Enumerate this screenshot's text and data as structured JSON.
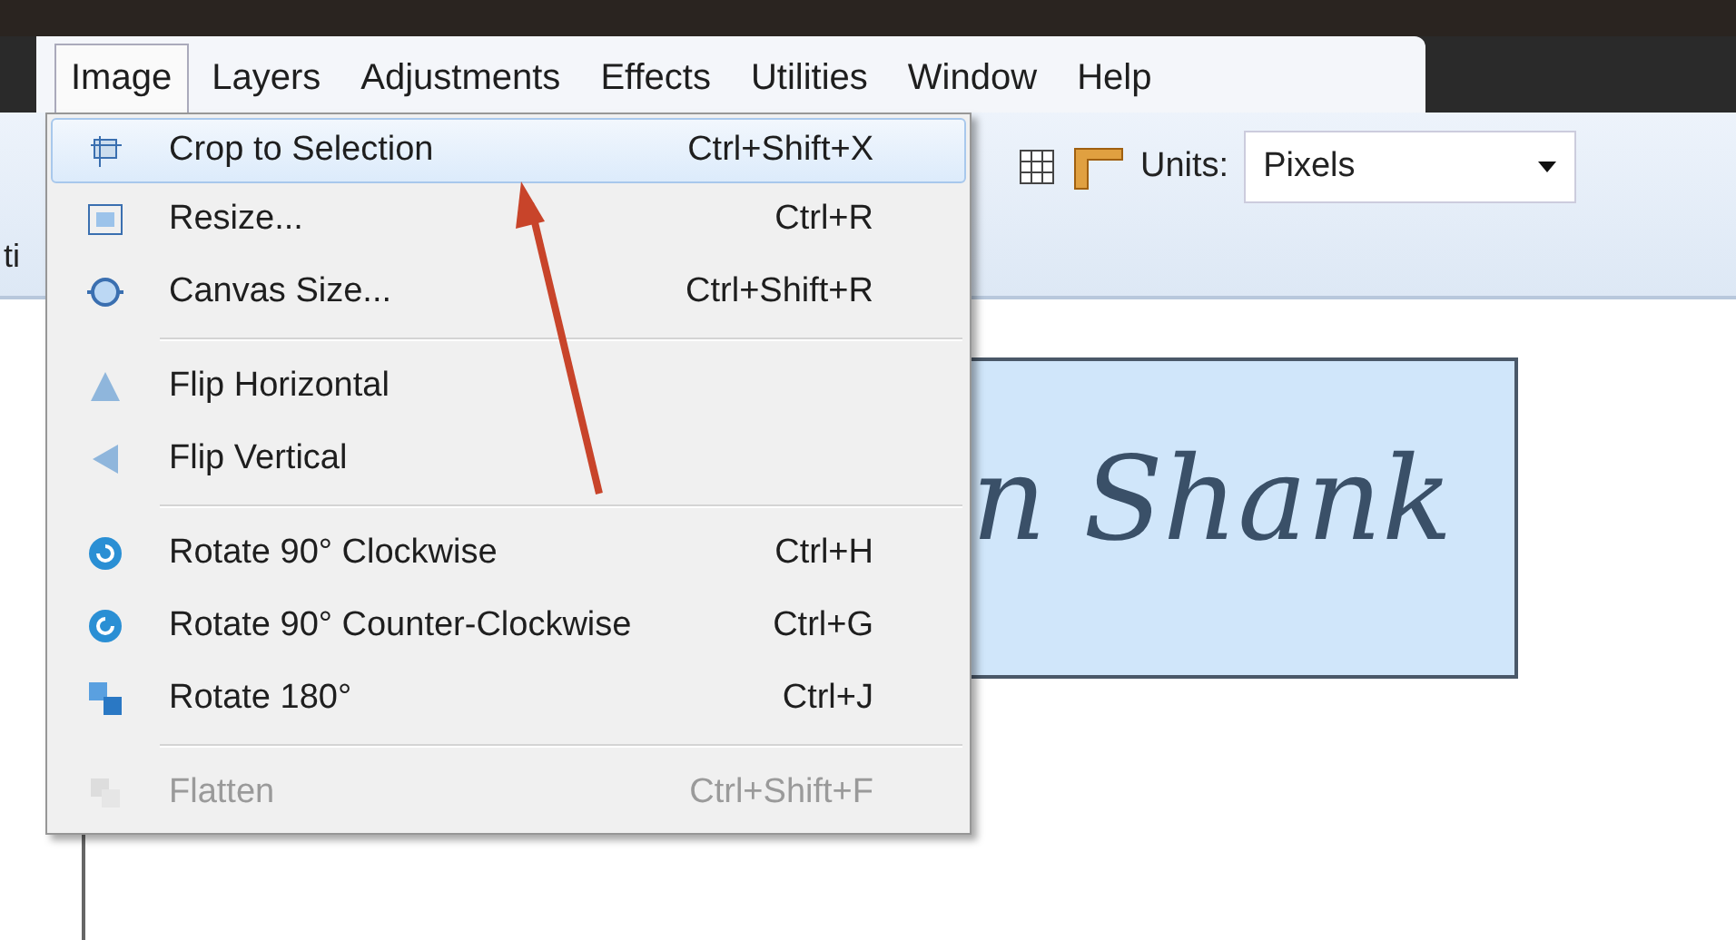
{
  "menu_bar": [
    {
      "label": "Image",
      "selected": true
    },
    {
      "label": "Layers",
      "selected": false
    },
    {
      "label": "Adjustments",
      "selected": false
    },
    {
      "label": "Effects",
      "selected": false
    },
    {
      "label": "Utilities",
      "selected": false
    },
    {
      "label": "Window",
      "selected": false
    },
    {
      "label": "Help",
      "selected": false
    }
  ],
  "toolbar": {
    "cut_label": "ti",
    "units_label": "Units:",
    "units_value": "Pixels"
  },
  "image_menu": [
    {
      "kind": "item",
      "label": "Crop to Selection",
      "shortcut": "Ctrl+Shift+X",
      "selected": true,
      "disabled": false
    },
    {
      "kind": "item",
      "label": "Resize...",
      "shortcut": "Ctrl+R",
      "selected": false,
      "disabled": false
    },
    {
      "kind": "item",
      "label": "Canvas Size...",
      "shortcut": "Ctrl+Shift+R",
      "selected": false,
      "disabled": false
    },
    {
      "kind": "separator"
    },
    {
      "kind": "item",
      "label": "Flip Horizontal",
      "selected": false,
      "disabled": false
    },
    {
      "kind": "item",
      "label": "Flip Vertical",
      "selected": false,
      "disabled": false
    },
    {
      "kind": "separator"
    },
    {
      "kind": "item",
      "label": "Rotate 90° Clockwise",
      "shortcut": "Ctrl+H",
      "selected": false,
      "disabled": false
    },
    {
      "kind": "item",
      "label": "Rotate 90° Counter-Clockwise",
      "shortcut": "Ctrl+G",
      "selected": false,
      "disabled": false
    },
    {
      "kind": "item",
      "label": "Rotate 180°",
      "shortcut": "Ctrl+J",
      "selected": false,
      "disabled": false
    },
    {
      "kind": "separator"
    },
    {
      "kind": "item",
      "label": "Flatten",
      "shortcut": "Ctrl+Shift+F",
      "selected": false,
      "disabled": true
    }
  ],
  "canvas": {
    "signature": "n Shank"
  }
}
